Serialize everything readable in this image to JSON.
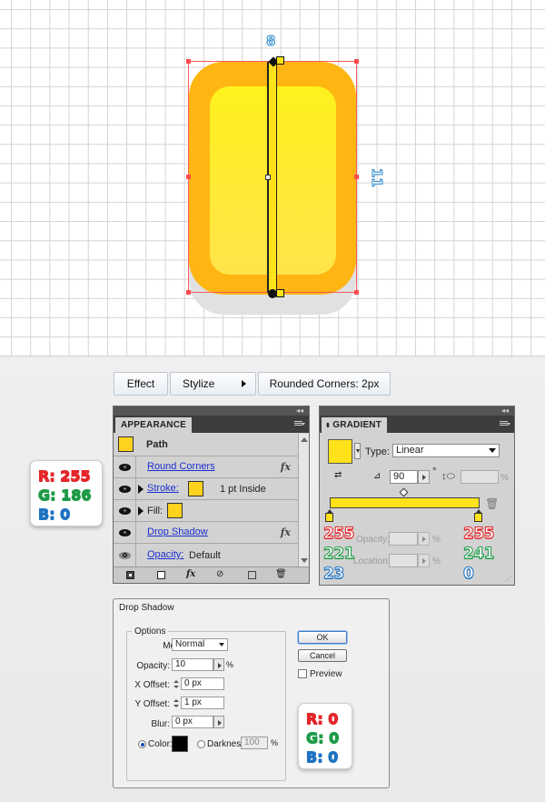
{
  "canvas": {
    "width_label": "8",
    "height_label": "11"
  },
  "effect_menu": {
    "effect": "Effect",
    "stylize": "Stylize",
    "rounded_corners": "Rounded Corners: 2px"
  },
  "rgb_main": {
    "r": "R: 255",
    "g": "G: 186",
    "b": "B: 0"
  },
  "appearance": {
    "tab": "APPEARANCE",
    "path_label": "Path",
    "round_corners": "Round Corners",
    "stroke_label": "Stroke:",
    "stroke_value": "1 pt  Inside",
    "fill_label": "Fill:",
    "drop_shadow": "Drop Shadow",
    "opacity_label": "Opacity:",
    "opacity_value": "Default",
    "fx": "fx"
  },
  "gradient": {
    "tab": "GRADIENT",
    "type_label": "Type:",
    "type_value": "Linear",
    "angle": "90",
    "degree": "°",
    "opacity_label": "Opacity:",
    "location_label": "Location:",
    "percent": "%",
    "left_stop": {
      "r": "255",
      "g": "221",
      "b": "23"
    },
    "right_stop": {
      "r": "255",
      "g": "241",
      "b": "0"
    }
  },
  "dialog": {
    "title": "Drop Shadow",
    "options": "Options",
    "mode_label": "Mode:",
    "mode_value": "Normal",
    "opacity_label": "Opacity:",
    "opacity_value": "10",
    "opacity_unit": "%",
    "x_offset_label": "X Offset:",
    "x_offset_value": "0 px",
    "y_offset_label": "Y Offset:",
    "y_offset_value": "1 px",
    "blur_label": "Blur:",
    "blur_value": "0 px",
    "color_label": "Color:",
    "darkness_label": "Darkness:",
    "darkness_value": "100",
    "darkness_unit": "%",
    "ok": "OK",
    "cancel": "Cancel",
    "preview": "Preview"
  },
  "rgb_shadow": {
    "r": "R: 0",
    "g": "G: 0",
    "b": "B: 0"
  },
  "colors": {
    "outer_fill": "#ffb612",
    "inner_fill": "#fff11d",
    "stroke_color": "#ffd21e",
    "gradient_color": "#ffe21a",
    "shadow_color": "#000000"
  }
}
